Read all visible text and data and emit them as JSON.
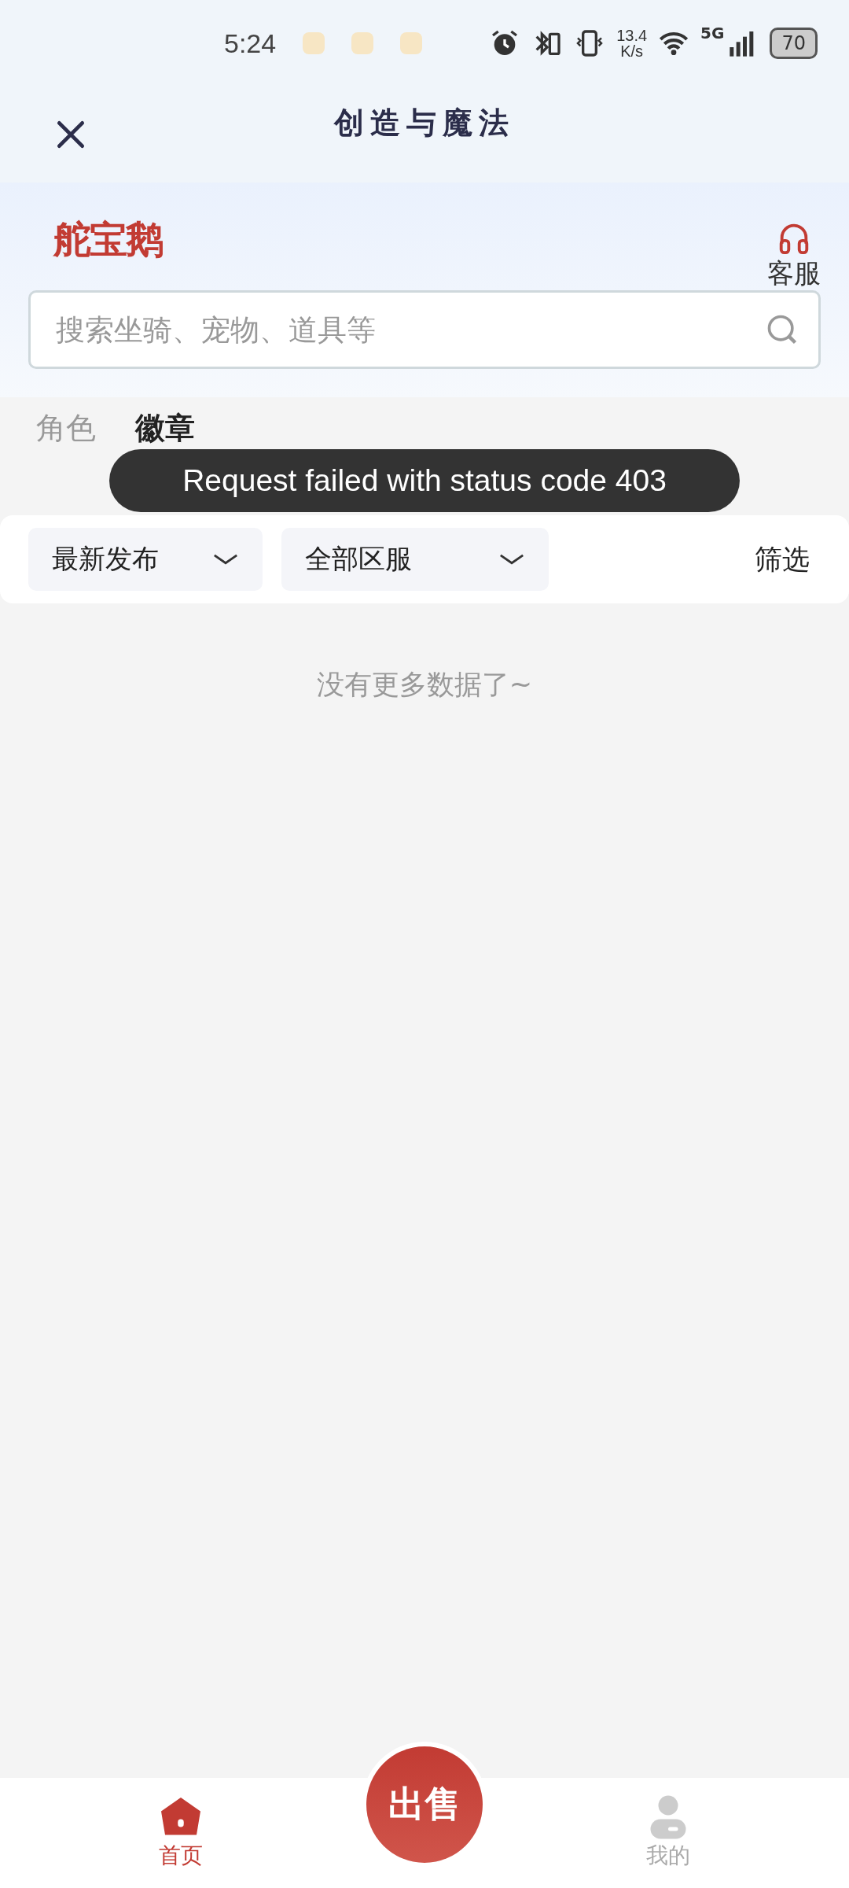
{
  "status_bar": {
    "time": "5:24",
    "net_speed": [
      "13.4",
      "K/s"
    ],
    "network": "5G",
    "battery": "70"
  },
  "header": {
    "title": "创造与魔法"
  },
  "brand": {
    "logo": "舵宝鹅",
    "service": "客服"
  },
  "search": {
    "placeholder": "搜索坐骑、宠物、道具等"
  },
  "tabs": [
    {
      "label": "角色",
      "selected": false
    },
    {
      "label": "徽章",
      "selected": true
    }
  ],
  "toast": "Request failed with status code 403",
  "filters": [
    {
      "label": "最新发布"
    },
    {
      "label": "全部区服"
    }
  ],
  "filter_button": "筛选",
  "empty_message": "没有更多数据了~",
  "bottom_nav": [
    {
      "kind": "home",
      "label": "首页",
      "selected": true
    },
    {
      "kind": "sell",
      "label": "出售",
      "selected": false
    },
    {
      "kind": "profile",
      "label": "我的",
      "selected": false
    }
  ]
}
